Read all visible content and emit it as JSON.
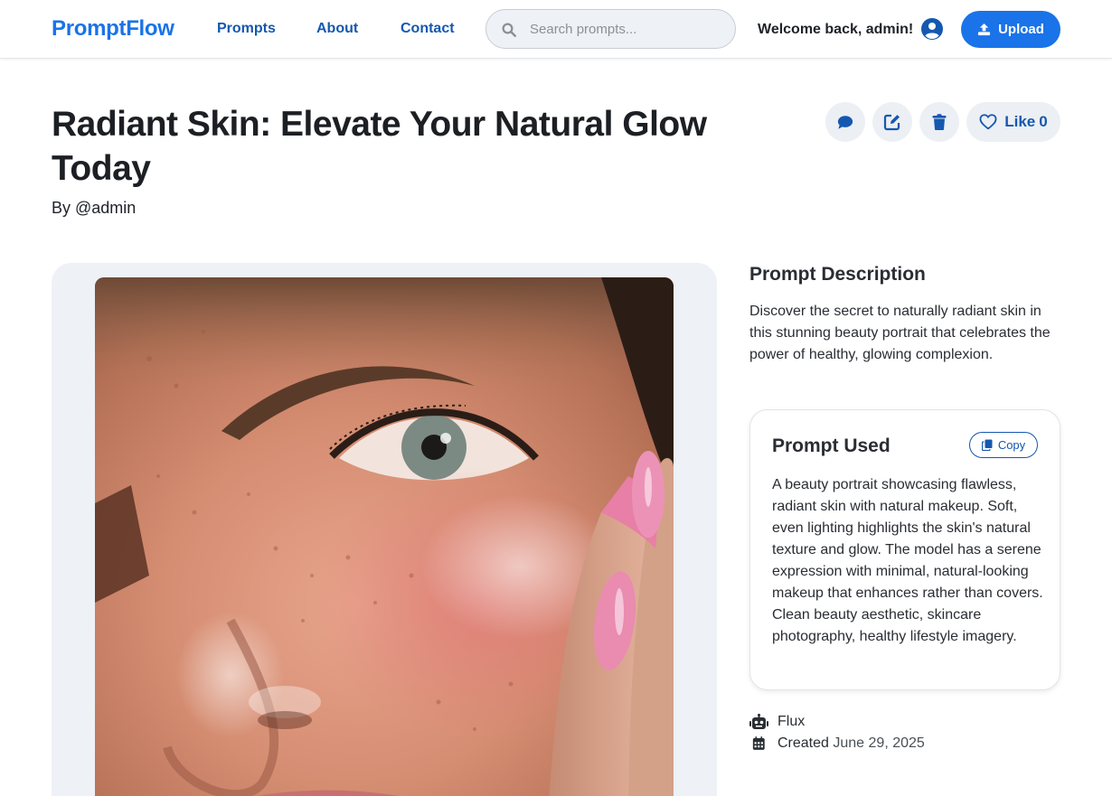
{
  "header": {
    "brand": "PromptFlow",
    "nav": [
      {
        "label": "Prompts"
      },
      {
        "label": "About"
      },
      {
        "label": "Contact"
      }
    ],
    "search_placeholder": "Search prompts...",
    "welcome": "Welcome back, admin!",
    "upload_label": "Upload"
  },
  "prompt": {
    "title": "Radiant Skin: Elevate Your Natural Glow Today",
    "author": "By @admin",
    "like_label": "Like",
    "like_count": "0",
    "description_heading": "Prompt Description",
    "description": "Discover the secret to naturally radiant skin in this stunning beauty portrait that celebrates the power of healthy, glowing complexion.",
    "prompt_used_heading": "Prompt Used",
    "copy_label": "Copy",
    "prompt_text": "A beauty portrait showcasing flawless, radiant skin with natural makeup. Soft, even lighting highlights the skin's natural texture and glow. The model has a serene expression with minimal, natural-looking makeup that enhances rather than covers. Clean beauty aesthetic, skincare photography, healthy lifestyle imagery.",
    "model": "Flux",
    "created_label": "Created",
    "created_date": "June 29, 2025"
  },
  "colors": {
    "primary": "#1a73e8",
    "link": "#1558b0",
    "panel_bg": "#eef1f5"
  },
  "icons": [
    "search-icon",
    "user-circle-icon",
    "upload-icon",
    "comment-icon",
    "edit-icon",
    "trash-icon",
    "heart-icon",
    "copy-icon",
    "robot-icon",
    "calendar-icon"
  ]
}
